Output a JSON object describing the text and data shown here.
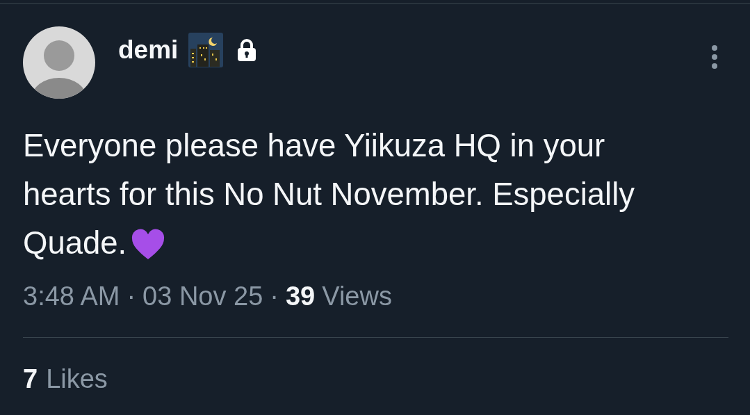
{
  "post": {
    "author": {
      "name": "demi",
      "locked": true
    },
    "text": "Everyone please have Yiikuza HQ in your hearts for this No Nut November. Especially Quade.",
    "time": "3:48 AM",
    "separator": "·",
    "date": "03 Nov 25",
    "views_count": "39",
    "views_label": "Views",
    "likes_count": "7",
    "likes_label": "Likes"
  }
}
